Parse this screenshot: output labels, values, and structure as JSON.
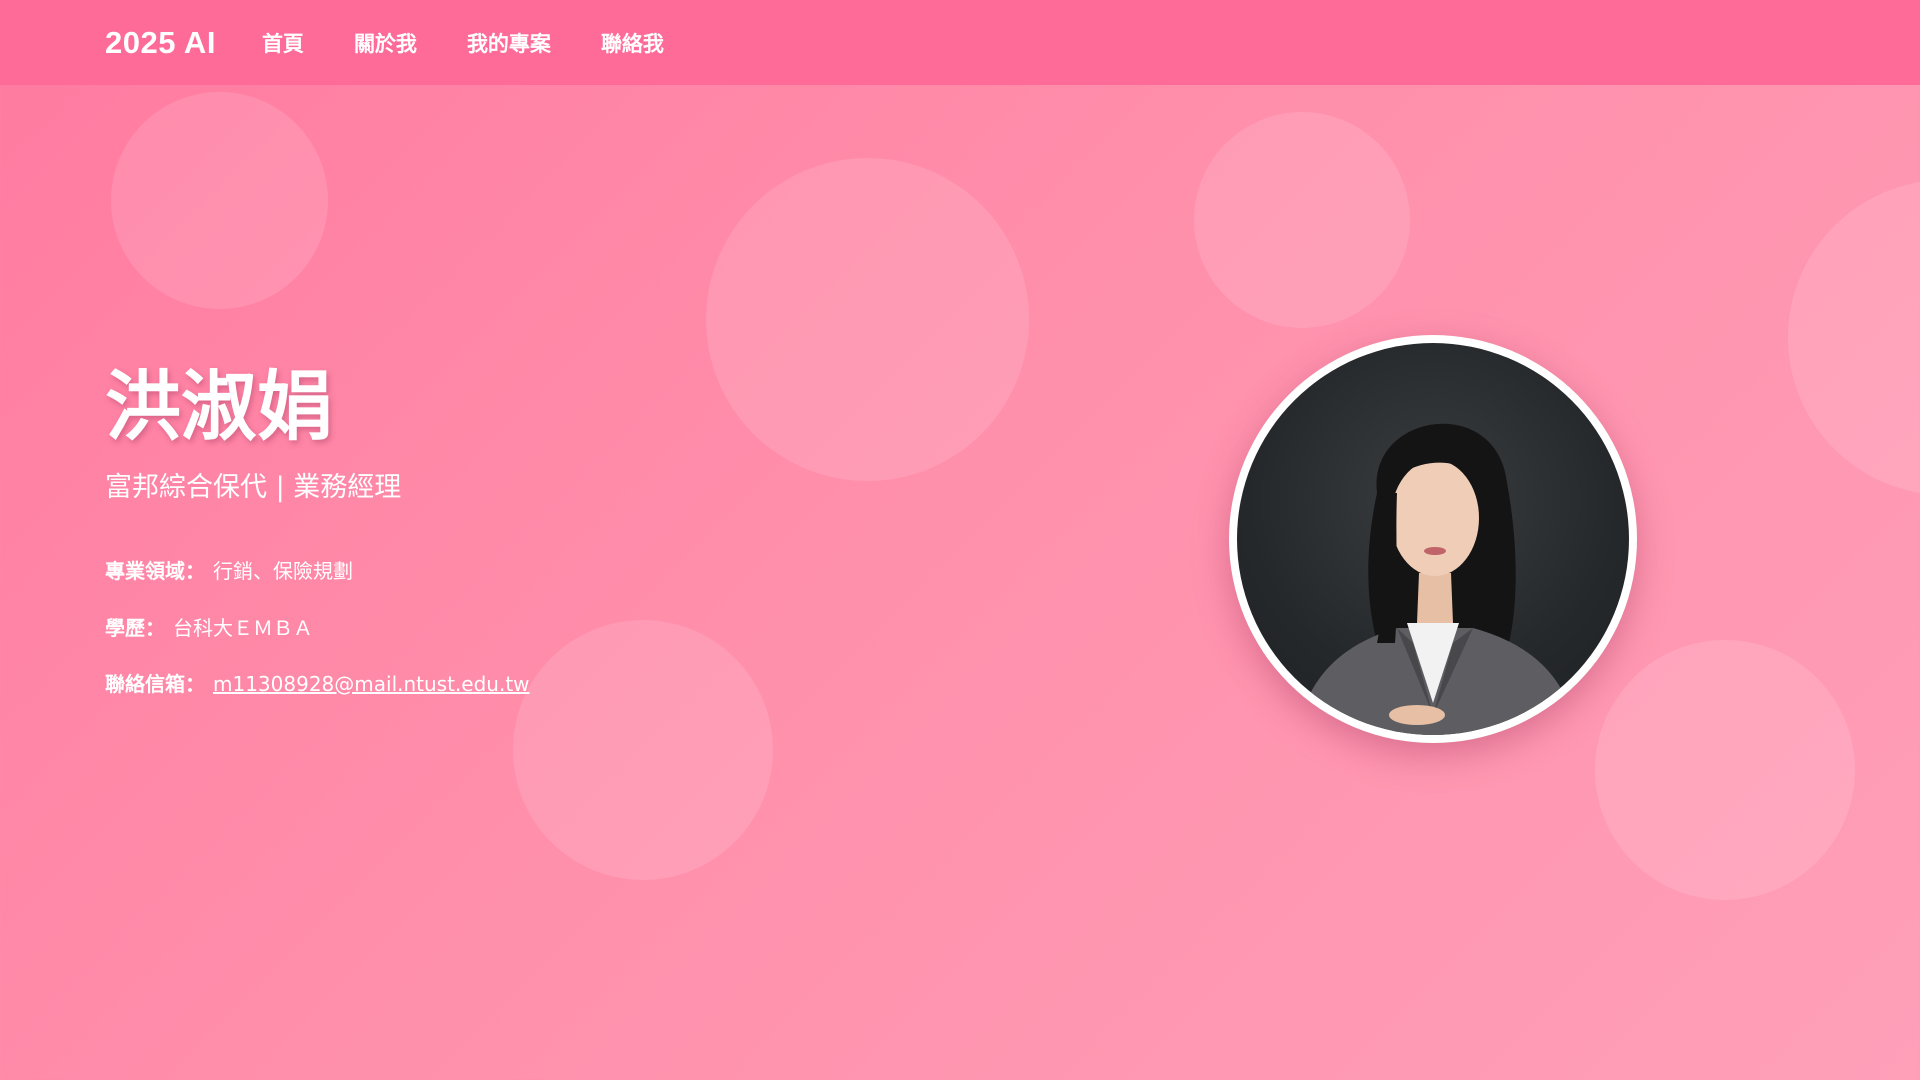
{
  "navbar": {
    "brand": "2025 AI",
    "links": [
      "首頁",
      "關於我",
      "我的專案",
      "聯絡我"
    ]
  },
  "hero": {
    "name": "洪淑娟",
    "title": "富邦綜合保代 | 業務經理",
    "info": [
      {
        "label": "專業領域：",
        "value": "行銷、保險規劃"
      },
      {
        "label": "學歷：",
        "value": "台科大ＥＭＢＡ"
      },
      {
        "label": "聯絡信箱：",
        "value": "m11308928@mail.ntust.edu.tw"
      }
    ]
  },
  "profile_photo": {
    "alt": "洪淑娟"
  },
  "colors": {
    "navbar": "#ff6b99",
    "background_start": "#ff7aa0",
    "background_end": "#ff9fb8",
    "text": "#ffffff"
  }
}
